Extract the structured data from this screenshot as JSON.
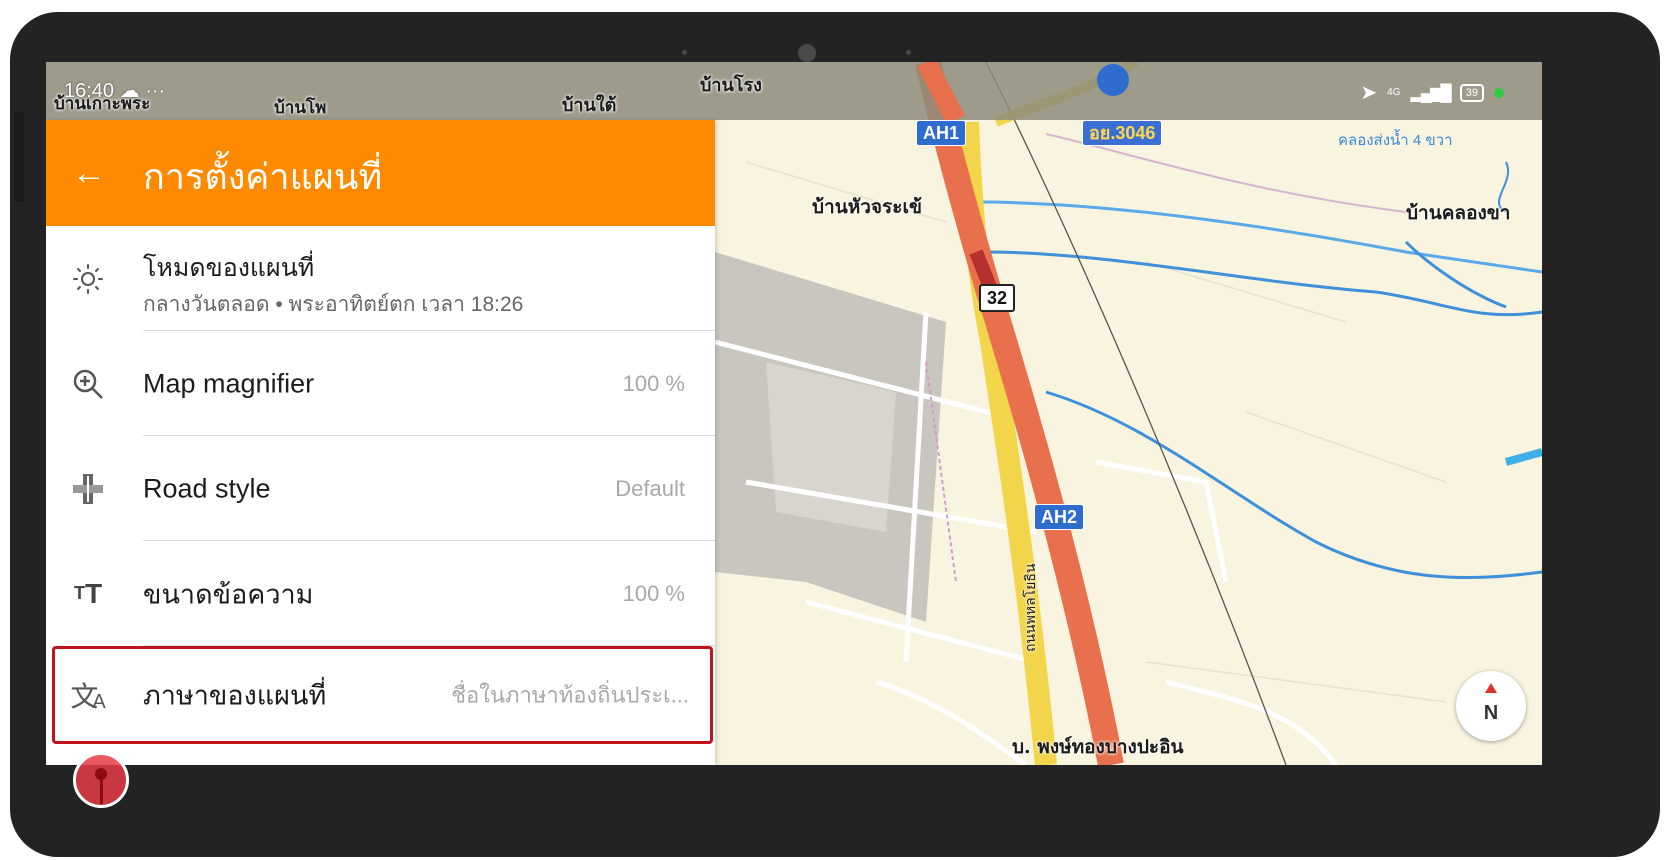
{
  "status_bar": {
    "time": "16:40",
    "network": "4G",
    "battery": "39"
  },
  "map": {
    "labels": {
      "village_1": "บ้านเกาะพระ",
      "village_2": "บ้านโพ",
      "village_3": "บ้านใต้",
      "village_4": "บ้านโรง",
      "village_5": "บ้านหัวจระเข้",
      "village_6": "บ้านคลองขา",
      "village_7": "บ. พงษ์ทองบางปะอิน",
      "canal": "คลองส่งน้ำ 4 ขวา",
      "road_vertical": "ถนนพหลโยธิน"
    },
    "shields": {
      "ah1": "AH1",
      "ay3046": "อย.3046",
      "r32": "32",
      "ah2": "AH2"
    },
    "compass_label": "N"
  },
  "settings": {
    "title": "การตั้งค่าแผนที่",
    "items": [
      {
        "label": "โหมดของแผนที่",
        "sub": "กลางวันตลอด • พระอาทิตย์ตก เวลา 18:26"
      },
      {
        "label": "Map magnifier",
        "value": "100 %"
      },
      {
        "label": "Road style",
        "value": "Default"
      },
      {
        "label": "ขนาดข้อความ",
        "value": "100 %"
      },
      {
        "label": "ภาษาของแผนที่",
        "value": "ชื่อในภาษาท้องถิ่นประเ..."
      }
    ]
  },
  "colors": {
    "accent": "#ff8a00",
    "highlight": "#c0141c",
    "map_bg": "#f8f4df"
  }
}
